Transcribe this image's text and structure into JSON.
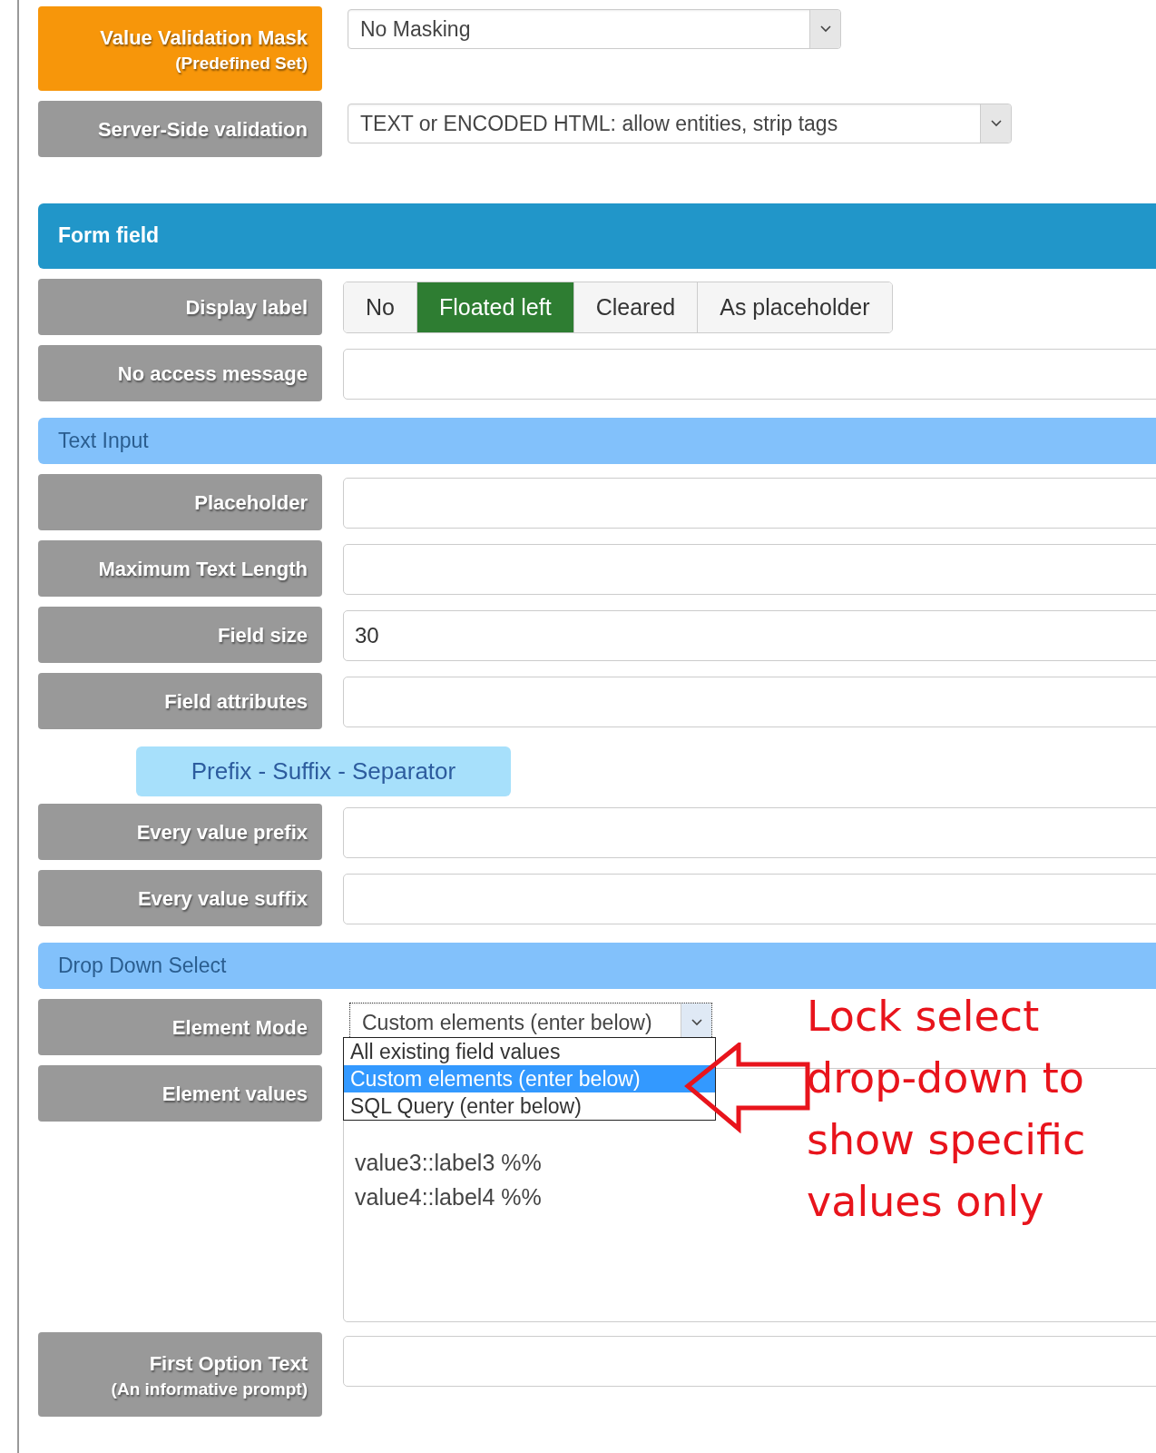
{
  "rows": [
    {
      "kind": "select",
      "label": "Value Validation Mask",
      "sublabel": "(Predefined Set)",
      "highlighted": true,
      "value": "No Masking",
      "wide": false
    },
    {
      "kind": "select",
      "label": "Server-Side validation",
      "highlighted": false,
      "value": "TEXT or ENCODED HTML: allow entities, strip tags",
      "wide": true
    },
    {
      "kind": "header",
      "label": "Form field"
    },
    {
      "kind": "toggle",
      "label": "Display label",
      "options": [
        {
          "label": "No",
          "selected": false
        },
        {
          "label": "Floated left",
          "selected": true
        },
        {
          "label": "Cleared",
          "selected": false
        },
        {
          "label": "As placeholder",
          "selected": false
        }
      ]
    },
    {
      "kind": "input",
      "label": "No access message"
    },
    {
      "kind": "subheader",
      "label": "Text Input"
    },
    {
      "kind": "input",
      "label": "Placeholder"
    },
    {
      "kind": "input",
      "label": "Maximum Text Length"
    },
    {
      "kind": "input",
      "label": "Field size",
      "value": "30"
    },
    {
      "kind": "input",
      "label": "Field attributes"
    },
    {
      "kind": "pill",
      "label": "Prefix - Suffix - Separator"
    },
    {
      "kind": "input",
      "label": "Every value prefix"
    },
    {
      "kind": "input",
      "label": "Every value suffix"
    },
    {
      "kind": "subheader",
      "label": "Drop Down Select"
    },
    {
      "kind": "dropdown",
      "label": "Element Mode",
      "value": "Custom elements (enter below)",
      "options": [
        {
          "label": "All existing field values",
          "selected": false
        },
        {
          "label": "Custom elements (enter below)",
          "selected": true
        },
        {
          "label": "SQL Query (enter below)",
          "selected": false
        }
      ],
      "annotation": [
        "Lock select",
        "drop-down to",
        "show specific",
        "values only"
      ]
    },
    {
      "kind": "textarea",
      "label": "Element values",
      "lines": [
        "value3::label3 %%",
        "value4::label4 %%"
      ]
    },
    {
      "kind": "input",
      "label": "First Option Text",
      "sublabel": "(An informative prompt)"
    }
  ]
}
